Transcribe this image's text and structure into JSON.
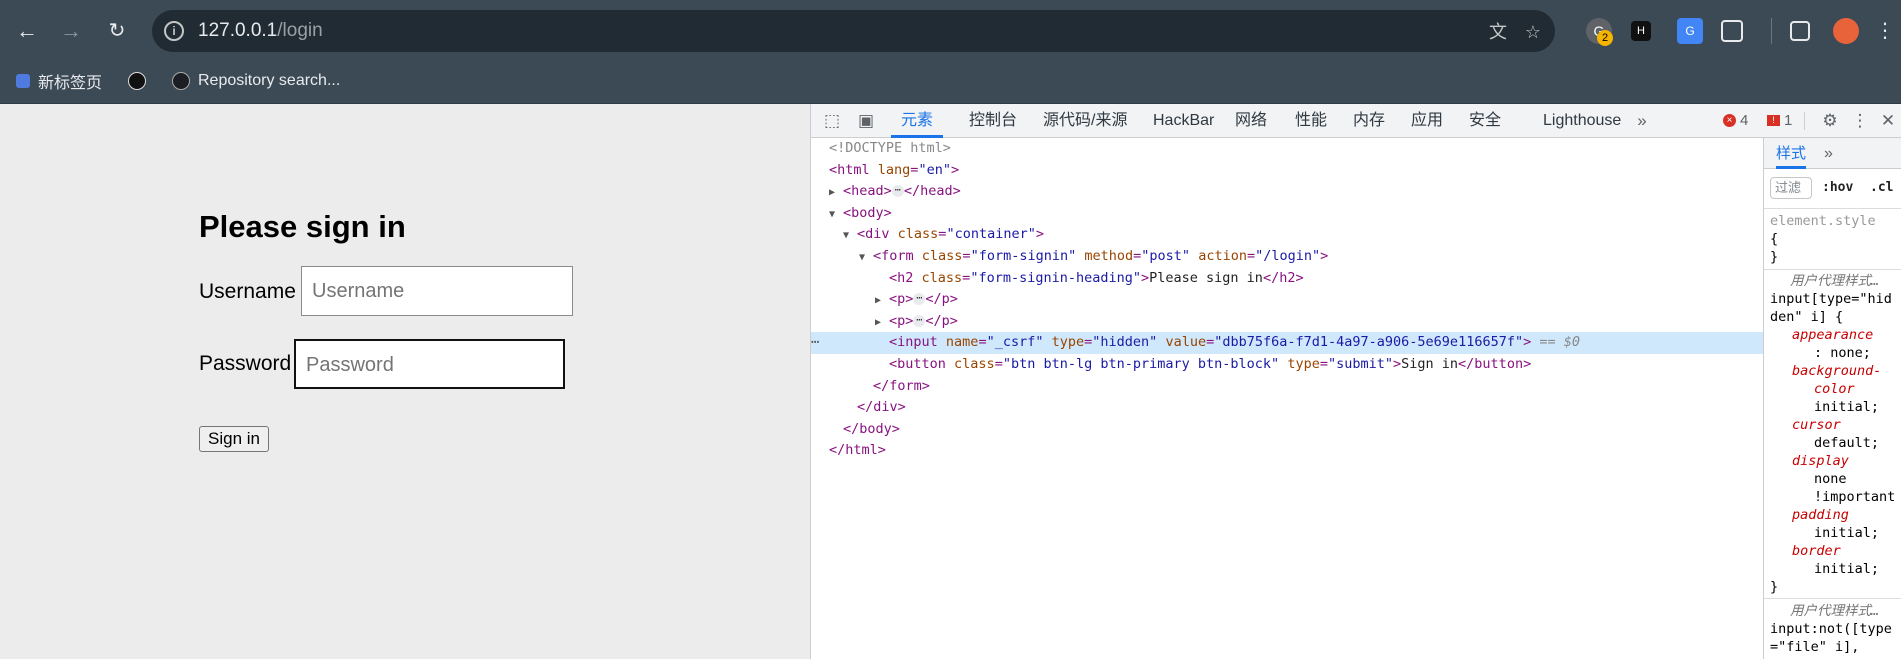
{
  "browser": {
    "url_host": "127.0.0.1",
    "url_path": "/login",
    "bookmarks": [
      "新标签页",
      "",
      "Repository search..."
    ],
    "ext_badge": "2"
  },
  "page": {
    "heading": "Please sign in",
    "username_label": "Username",
    "username_placeholder": "Username",
    "password_label": "Password",
    "password_placeholder": "Password",
    "signin_label": "Sign in"
  },
  "devtools": {
    "tabs": [
      "元素",
      "控制台",
      "源代码/来源",
      "HackBar",
      "网络",
      "性能",
      "内存",
      "应用",
      "安全",
      "Lighthouse"
    ],
    "error_count": "4",
    "issue_count": "1",
    "styles_tab": "样式",
    "filter_placeholder": "过滤",
    "hov": ":hov",
    "cls": ".cl",
    "dom": {
      "doctype": "<!DOCTYPE html>",
      "html_open_tag": "<html",
      "html_lang_attr": "lang",
      "html_lang_val": "\"en\"",
      "head_open": "<head>",
      "head_close": "</head>",
      "body_open": "<body>",
      "div_open": "<div",
      "div_class_attr": "class",
      "div_class_val": "\"container\"",
      "form_open": "<form",
      "form_class_attr": "class",
      "form_class_val": "\"form-signin\"",
      "form_method_attr": "method",
      "form_method_val": "\"post\"",
      "form_action_attr": "action",
      "form_action_val": "\"/login\"",
      "h2_open": "<h2",
      "h2_class_attr": "class",
      "h2_class_val": "\"form-signin-heading\"",
      "h2_text": "Please sign in",
      "h2_close": "</h2>",
      "p_open": "<p>",
      "p_close": "</p>",
      "input_open": "<input",
      "input_name_attr": "name",
      "input_name_val": "\"_csrf\"",
      "input_type_attr": "type",
      "input_type_val": "\"hidden\"",
      "input_value_attr": "value",
      "input_value_val": "\"dbb75f6a-f7d1-4a97-a906-5e69e116657f\"",
      "eq_dollar": "== $0",
      "button_open": "<button",
      "button_class_attr": "class",
      "button_class_val": "\"btn btn-lg btn-primary btn-block\"",
      "button_type_attr": "type",
      "button_type_val": "\"submit\"",
      "button_text": "Sign in",
      "button_close": "</button>",
      "form_close": "</form>",
      "div_close": "</div>",
      "body_close": "</body>",
      "html_close": "</html>"
    },
    "styles": {
      "element_style": "element.style",
      "open_brace": "{",
      "close_brace": "}",
      "ua_label": "用户代理样式…",
      "rule1_selector_a": "input[type=\"hid",
      "rule1_selector_b": "den\" i] {",
      "p1_name": "appearance",
      "p1_val": ": none;",
      "p2_name_a": "background-",
      "p2_name_b": "color",
      "p2_val": "initial;",
      "p3_name": "cursor",
      "p3_val": "default;",
      "p4_name": "display",
      "p4_val_a": "none",
      "p4_val_b": "!important",
      "p5_name": "padding",
      "p5_val": "initial;",
      "p6_name": "border",
      "p6_val": "initial;",
      "rule2_selector_a": "input:not([type",
      "rule2_selector_b": "=\"file\" i],"
    }
  }
}
